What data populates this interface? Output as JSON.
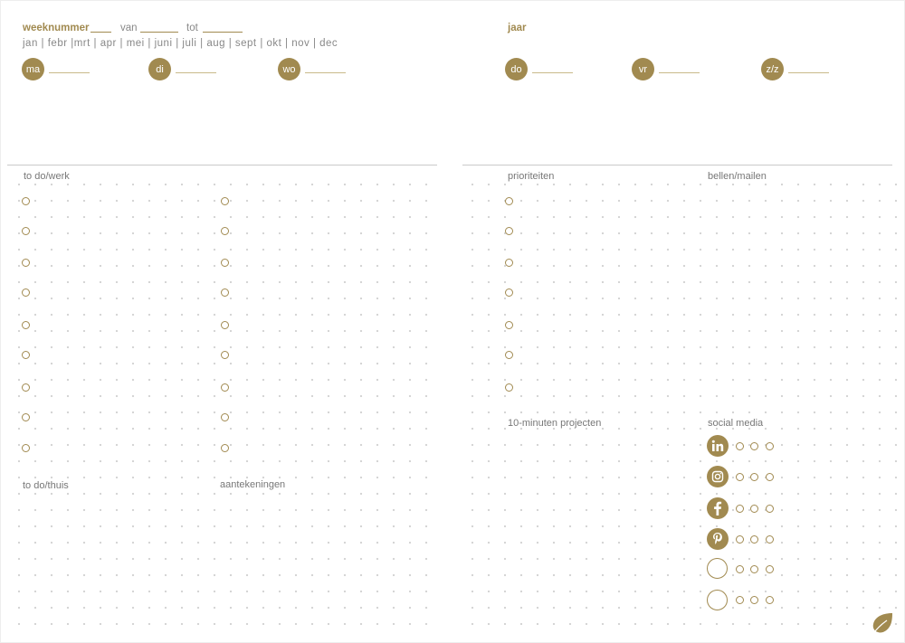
{
  "header": {
    "week_label": "weeknummer",
    "from_label": "van",
    "to_label": "tot",
    "year_label": "jaar",
    "months": "jan | febr |mrt | apr | mei | juni | juli | aug | sept | okt | nov | dec"
  },
  "days": [
    {
      "label": "ma"
    },
    {
      "label": "di"
    },
    {
      "label": "wo"
    },
    {
      "label": "do"
    },
    {
      "label": "vr"
    },
    {
      "label": "z/z"
    }
  ],
  "sections": {
    "todo_work": "to do/werk",
    "priorities": "prioriteiten",
    "call_mail": "bellen/mailen",
    "ten_minute_projects": "10-minuten projecten",
    "social_media": "social media",
    "todo_home": "to do/thuis",
    "notes": "aantekeningen"
  },
  "social_icons": [
    "linkedin-icon",
    "instagram-icon",
    "facebook-icon",
    "pinterest-icon",
    "empty-circle",
    "empty-circle"
  ],
  "colors": {
    "accent": "#a18a50",
    "divider": "#c9c9c9",
    "dot_grid": "#cfcfcf"
  }
}
